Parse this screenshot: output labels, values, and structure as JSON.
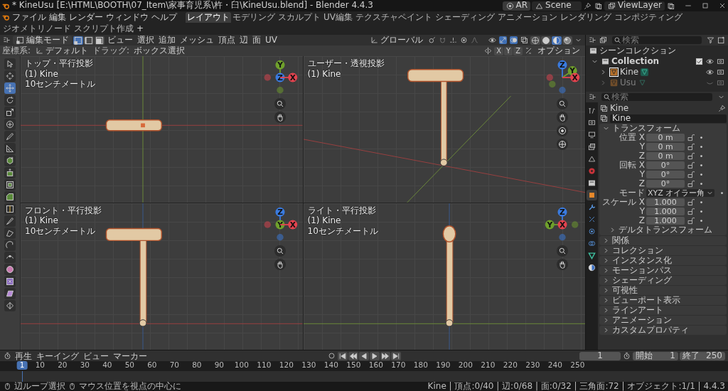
{
  "window": {
    "title": "* KineUsu [E:\\HTML\\BOOTH\\07_Item\\家事育児系\\杵・臼\\KineUsu.blend] - Blender 4.4.3"
  },
  "engine": "AR",
  "scene": "Scene",
  "view_layer": "ViewLayer",
  "menu": [
    "ファイル",
    "編集",
    "レンダー",
    "ウィンドウ",
    "ヘルプ"
  ],
  "workspaces": [
    {
      "label": "レイアウト",
      "selected": true
    },
    {
      "label": "モデリング",
      "selected": false
    },
    {
      "label": "スカルプト",
      "selected": false
    },
    {
      "label": "UV編集",
      "selected": false
    },
    {
      "label": "テクスチャペイント",
      "selected": false
    },
    {
      "label": "シェーディング",
      "selected": false
    },
    {
      "label": "アニメーション",
      "selected": false
    },
    {
      "label": "レンダリング",
      "selected": false
    },
    {
      "label": "コンポジティング",
      "selected": false
    },
    {
      "label": "ジオメトリノード",
      "selected": false
    },
    {
      "label": "スクリプト作成",
      "selected": false
    }
  ],
  "add_workspace": "+",
  "header": {
    "mode": "編集モード",
    "select_modes": [
      {
        "kind": "vertex",
        "selected": true
      },
      {
        "kind": "edge",
        "selected": false
      },
      {
        "kind": "face",
        "selected": false
      }
    ],
    "menus": [
      "ビュー",
      "選択",
      "追加",
      "メッシュ",
      "頂点",
      "辺",
      "面",
      "UV"
    ],
    "orientation": "グローバル"
  },
  "tool_settings": {
    "orientation_label": "座標系:",
    "orientation": "デフォルト",
    "drag_label": "ドラッグ:",
    "drag": "ボックス選択",
    "mirror_axes": [
      "X",
      "Y",
      "Z"
    ],
    "options": "オプション"
  },
  "toolbar": [
    {
      "kind": "select",
      "selected": false
    },
    {
      "kind": "cursor",
      "selected": false
    },
    {
      "kind": "move",
      "selected": true
    },
    {
      "kind": "rotate",
      "selected": false
    },
    {
      "kind": "scale",
      "selected": false
    },
    {
      "kind": "transform",
      "selected": false
    },
    {
      "kind": "annotate",
      "selected": false
    },
    {
      "kind": "measure",
      "selected": false
    },
    {
      "kind": "addcube",
      "selected": false
    },
    {
      "kind": "extrude",
      "selected": false
    },
    {
      "kind": "inset",
      "selected": false
    },
    {
      "kind": "bevel",
      "selected": false
    },
    {
      "kind": "loopcut",
      "selected": false
    },
    {
      "kind": "knife",
      "selected": false
    },
    {
      "kind": "polybuild",
      "selected": false
    },
    {
      "kind": "spin",
      "selected": false
    },
    {
      "kind": "smooth",
      "selected": false
    },
    {
      "kind": "sphere",
      "selected": false
    },
    {
      "kind": "shrink",
      "selected": false
    },
    {
      "kind": "shear",
      "selected": false
    },
    {
      "kind": "rip",
      "selected": false
    }
  ],
  "viewports": [
    {
      "kind": "top",
      "title": "トップ・平行投影",
      "object": "(1) Kine",
      "scale": "10センチメートル",
      "gizmo": [
        {
          "label": "Y",
          "color": "#6fa02c"
        },
        {
          "label": "Z",
          "color": "#3a7be0"
        },
        {
          "label": "X",
          "color": "#e3434f"
        }
      ]
    },
    {
      "kind": "user",
      "title": "ユーザー・透視投影",
      "object": "(1) Kine",
      "gizmo": [
        {
          "label": "Z",
          "color": "#3a7be0"
        },
        {
          "label": "Y",
          "color": "#6fa02c"
        },
        {
          "label": "X",
          "color": "#e3434f"
        }
      ]
    },
    {
      "kind": "front",
      "title": "フロント・平行投影",
      "object": "(1) Kine",
      "scale": "10センチメートル",
      "gizmo": [
        {
          "label": "Z",
          "color": "#3a7be0"
        },
        {
          "label": "Y",
          "color": "#6fa02c"
        },
        {
          "label": "X",
          "color": "#e3434f"
        }
      ]
    },
    {
      "kind": "right",
      "title": "ライト・平行投影",
      "object": "(1) Kine",
      "scale": "10センチメートル",
      "gizmo": [
        {
          "label": "Z",
          "color": "#3a7be0"
        },
        {
          "label": "Y",
          "color": "#6fa02c"
        },
        {
          "label": "X",
          "color": "#e3434f"
        }
      ]
    }
  ],
  "outliner": {
    "search_placeholder": "検索",
    "root": "シーンコレクション",
    "tree": [
      {
        "label": "Collection",
        "checked": true,
        "expanded": true,
        "children": [
          {
            "label": "Kine",
            "selected": true,
            "visible": true
          },
          {
            "label": "Usu",
            "selected": false,
            "visible": false
          }
        ]
      }
    ]
  },
  "properties": {
    "search_placeholder": "検索",
    "tabs": [
      {
        "kind": "tool",
        "selected": false
      },
      {
        "kind": "render",
        "selected": false
      },
      {
        "kind": "output",
        "selected": false
      },
      {
        "kind": "viewlayer",
        "selected": false
      },
      {
        "kind": "scene",
        "selected": false
      },
      {
        "kind": "world",
        "selected": false
      },
      {
        "kind": "collection",
        "selected": false
      },
      {
        "kind": "object",
        "selected": true
      },
      {
        "kind": "modifier",
        "selected": false
      },
      {
        "kind": "particles",
        "selected": false
      },
      {
        "kind": "physics",
        "selected": false
      },
      {
        "kind": "constraints",
        "selected": false
      },
      {
        "kind": "data",
        "selected": false
      },
      {
        "kind": "material",
        "selected": false
      }
    ],
    "object": "Kine",
    "name": "Kine",
    "transform": {
      "title": "トランスフォーム",
      "expanded": true,
      "rows": [
        {
          "kind": "field",
          "label": "位置 X",
          "value": "0 m"
        },
        {
          "kind": "field",
          "label": "Y",
          "value": "0 m"
        },
        {
          "kind": "field",
          "label": "Z",
          "value": "0 m"
        },
        {
          "kind": "field",
          "label": "回転 X",
          "value": "0°"
        },
        {
          "kind": "field",
          "label": "Y",
          "value": "0°"
        },
        {
          "kind": "field",
          "label": "Z",
          "value": "0°"
        },
        {
          "kind": "dropdown",
          "label": "モード",
          "value": "XYZ オイラー角"
        },
        {
          "kind": "field",
          "label": "スケール X",
          "value": "1.000"
        },
        {
          "kind": "field",
          "label": "Y",
          "value": "1.000"
        },
        {
          "kind": "field",
          "label": "Z",
          "value": "1.000"
        }
      ],
      "subpanel": {
        "label": "デルタトランスフォーム",
        "expanded": false
      }
    },
    "panels": [
      {
        "label": "関係",
        "expanded": false
      },
      {
        "label": "コレクション",
        "expanded": false
      },
      {
        "label": "インスタンス化",
        "expanded": false
      },
      {
        "label": "モーションパス",
        "expanded": false
      },
      {
        "label": "シェーディング",
        "expanded": false
      },
      {
        "label": "可視性",
        "expanded": false
      },
      {
        "label": "ビューポート表示",
        "expanded": false
      },
      {
        "label": "ラインアート",
        "expanded": false
      },
      {
        "label": "アニメーション",
        "expanded": false
      },
      {
        "label": "カスタムプロパティ",
        "expanded": false
      }
    ]
  },
  "timeline": {
    "menus": [
      "再生",
      "キーイング",
      "ビュー",
      "マーカー"
    ],
    "current_frame": "1",
    "start_label": "開始",
    "start": "1",
    "end_label": "終了",
    "end": "250",
    "playhead": "1",
    "ruler": [
      "10",
      "20",
      "30",
      "40",
      "50",
      "60",
      "70",
      "80",
      "90",
      "100",
      "110",
      "120",
      "130",
      "140",
      "150",
      "160",
      "170",
      "180",
      "190",
      "200",
      "210",
      "220",
      "230",
      "240",
      "250"
    ]
  },
  "status": {
    "hints": [
      "辺ループ選択",
      "マウス位置を視点の中心に"
    ],
    "stats": "Kine | 頂点:0/40 | 辺:0/68 | 面:0/32 | 三角面:72 | オブジェクト:1/1 | 4.4.3"
  }
}
